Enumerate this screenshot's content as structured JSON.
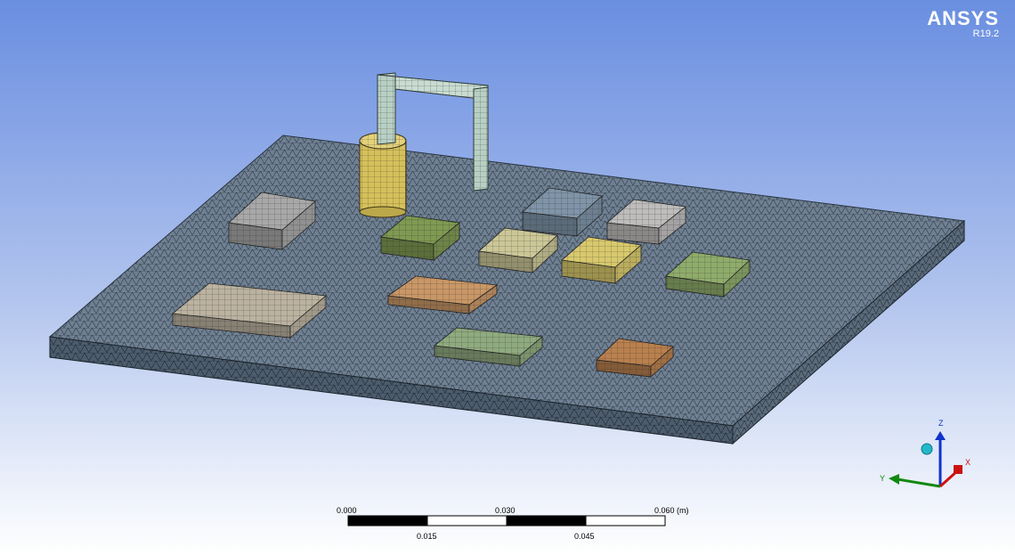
{
  "app": {
    "brand": "ANSYS",
    "version": "R19.2"
  },
  "scene": {
    "plate_color": "#6f8092",
    "components": [
      {
        "name": "large-tan-component",
        "color": "#bbb2a0"
      },
      {
        "name": "gray-component",
        "color": "#a8a8a8"
      },
      {
        "name": "olive-green-component",
        "color": "#7f9a52"
      },
      {
        "name": "cream-component",
        "color": "#ccc797"
      },
      {
        "name": "slate-blue-component",
        "color": "#7f94a8"
      },
      {
        "name": "light-gray-component",
        "color": "#bfbcbc"
      },
      {
        "name": "yellow-component",
        "color": "#d8c96d"
      },
      {
        "name": "green-right-component",
        "color": "#8fac6b"
      },
      {
        "name": "orange-component",
        "color": "#c99767"
      },
      {
        "name": "sage-component",
        "color": "#8faa7f"
      },
      {
        "name": "brown-component",
        "color": "#b9804e"
      },
      {
        "name": "yellow-cylinder",
        "color": "#d6c05a"
      },
      {
        "name": "handle-frame",
        "color": "#b8d0c4"
      }
    ]
  },
  "triad": {
    "x_label": "X",
    "y_label": "Y",
    "z_label": "Z",
    "x_color": "#cc1111",
    "y_color": "#118811",
    "z_color": "#1133cc",
    "iso_color": "#22b8c8"
  },
  "scale_bar": {
    "top_labels": [
      "0.000",
      "0.030",
      "0.060 (m)"
    ],
    "bottom_labels": [
      "0.015",
      "0.045"
    ]
  }
}
